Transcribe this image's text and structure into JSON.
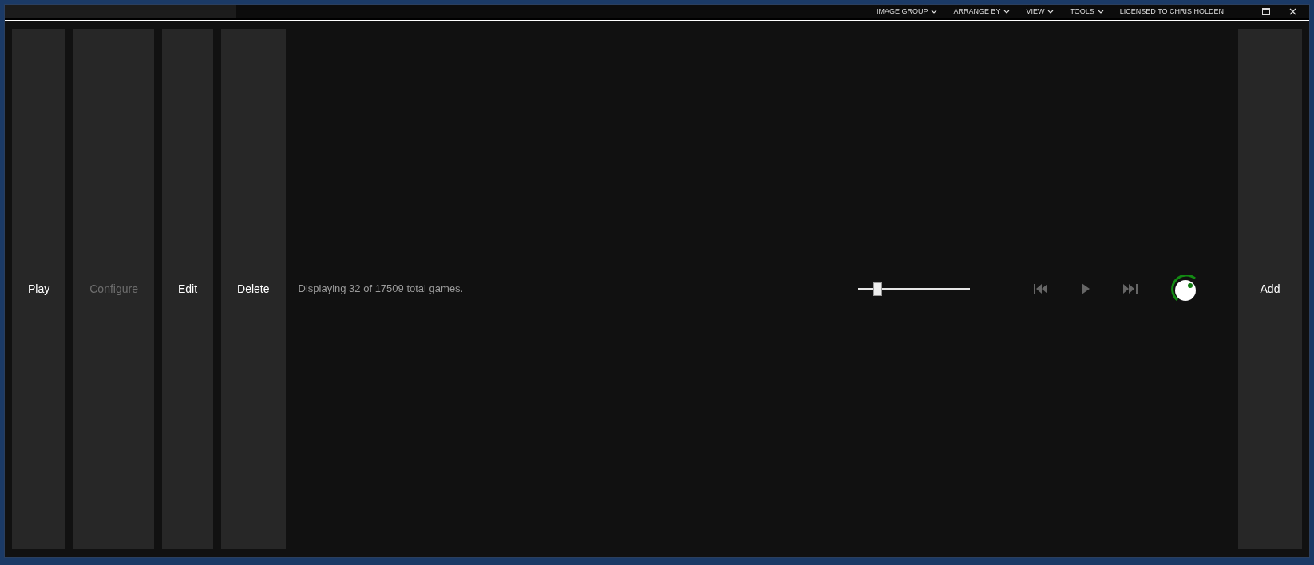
{
  "menu": [
    {
      "label": "IMAGE GROUP"
    },
    {
      "label": "ARRANGE BY"
    },
    {
      "label": "VIEW"
    },
    {
      "label": "TOOLS"
    }
  ],
  "license": "LICENSED TO CHRIS HOLDEN",
  "actions": [
    {
      "label": "Play",
      "disabled": false
    },
    {
      "label": "Configure",
      "disabled": true
    },
    {
      "label": "Edit",
      "disabled": false
    },
    {
      "label": "Delete",
      "disabled": false
    }
  ],
  "status": "Displaying 32 of 17509 total games.",
  "zoom_slider": {
    "level": 0.15
  },
  "add_button": {
    "label": "Add"
  }
}
